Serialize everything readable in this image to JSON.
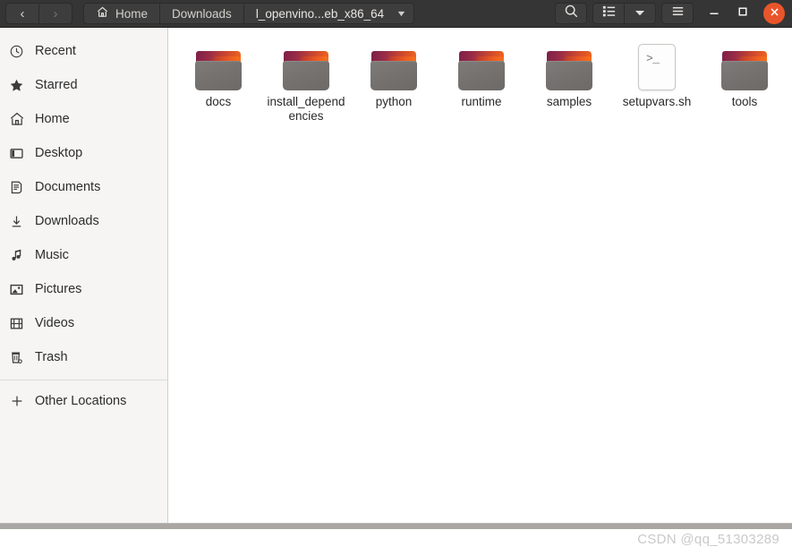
{
  "header": {
    "nav": {
      "back_label": "‹",
      "back_icon": "chevron-left-icon",
      "forward_label": "›",
      "forward_icon": "chevron-right-icon"
    },
    "breadcrumbs": [
      {
        "label": "Home",
        "icon": "home-icon"
      },
      {
        "label": "Downloads",
        "icon": ""
      },
      {
        "label": "l_openvino...eb_x86_64",
        "icon": "",
        "caret": "▼"
      }
    ],
    "toolbar": {
      "search_icon": "search-icon",
      "view_list_icon": "list-view-icon",
      "view_dropdown_caret": "▼",
      "menu_icon": "hamburger-menu-icon"
    },
    "window_controls": {
      "minimize": "–",
      "maximize": "□",
      "close": "✕"
    }
  },
  "sidebar": {
    "items": [
      {
        "label": "Recent",
        "icon": "clock-icon"
      },
      {
        "label": "Starred",
        "icon": "star-icon"
      },
      {
        "label": "Home",
        "icon": "home-icon"
      },
      {
        "label": "Desktop",
        "icon": "desktop-icon"
      },
      {
        "label": "Documents",
        "icon": "document-icon"
      },
      {
        "label": "Downloads",
        "icon": "download-arrow-icon"
      },
      {
        "label": "Music",
        "icon": "music-note-icon"
      },
      {
        "label": "Pictures",
        "icon": "picture-icon"
      },
      {
        "label": "Videos",
        "icon": "film-icon"
      },
      {
        "label": "Trash",
        "icon": "trash-icon"
      }
    ],
    "other_locations": {
      "label": "Other Locations",
      "icon": "plus-icon"
    }
  },
  "files": [
    {
      "name": "docs",
      "type": "folder"
    },
    {
      "name": "install_dependencies",
      "type": "folder"
    },
    {
      "name": "python",
      "type": "folder"
    },
    {
      "name": "runtime",
      "type": "folder"
    },
    {
      "name": "samples",
      "type": "folder"
    },
    {
      "name": "setupvars.sh",
      "type": "script",
      "glyph": ">_"
    },
    {
      "name": "tools",
      "type": "folder"
    }
  ],
  "watermark": "CSDN @qq_51303289",
  "colors": {
    "headerbar": "#353535",
    "sidebar": "#f6f5f4",
    "close_button": "#e9552a",
    "folder_body": "#76726f",
    "folder_tab_start": "#7d2048",
    "folder_tab_end": "#f2661d"
  }
}
